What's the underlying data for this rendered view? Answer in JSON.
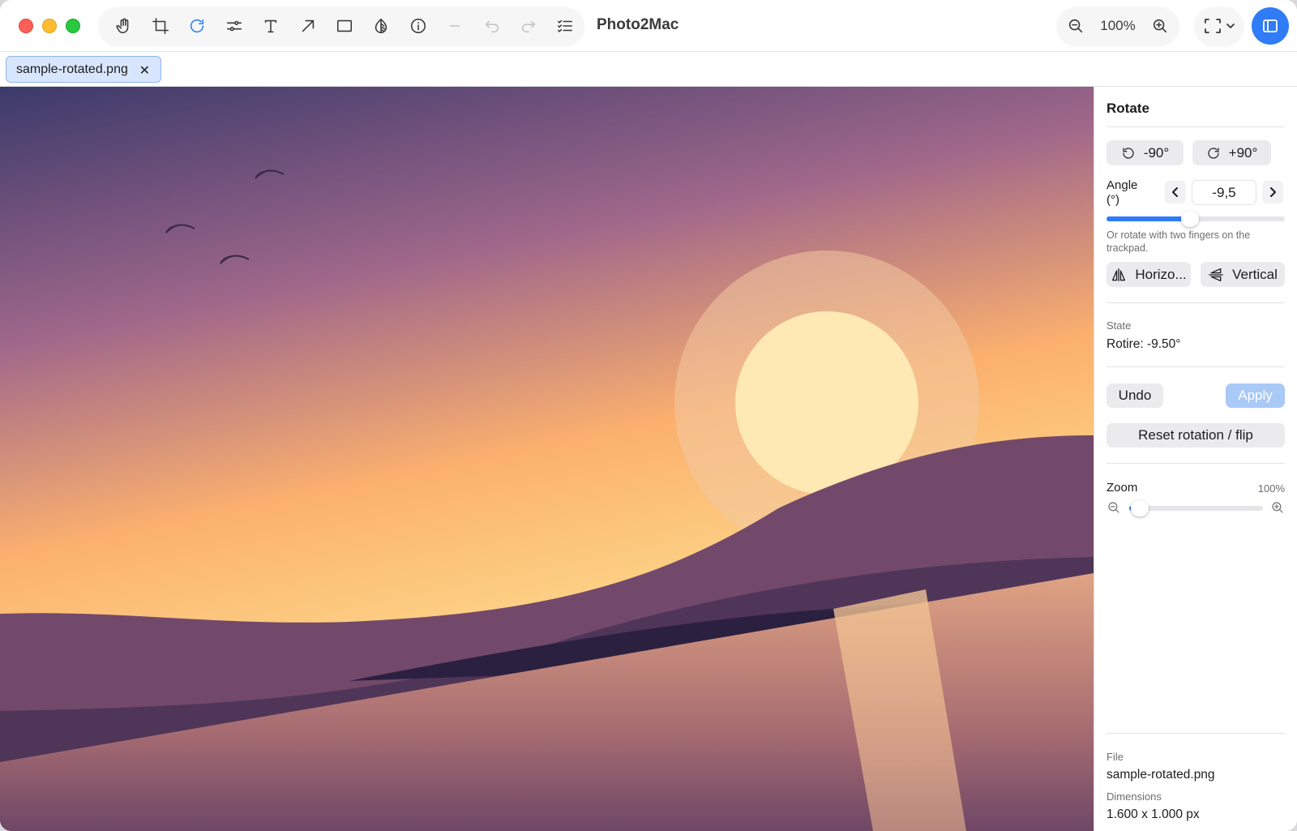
{
  "app": {
    "title": "Photo2Mac"
  },
  "toolbar": {
    "tools": [
      {
        "name": "hand-icon"
      },
      {
        "name": "crop-icon"
      },
      {
        "name": "rotate-icon",
        "active": true
      },
      {
        "name": "adjust-sliders-icon"
      },
      {
        "name": "text-icon"
      },
      {
        "name": "arrow-icon"
      },
      {
        "name": "rectangle-icon"
      },
      {
        "name": "mask-icon"
      },
      {
        "name": "info-icon"
      },
      {
        "name": "line-icon",
        "disabled": true
      },
      {
        "name": "undo-icon",
        "disabled": true
      },
      {
        "name": "redo-icon",
        "disabled": true
      },
      {
        "name": "checklist-icon"
      }
    ],
    "zoom_percent": "100%"
  },
  "tabs": [
    {
      "label": "sample-rotated.png",
      "close": "✕"
    }
  ],
  "sidebar": {
    "title": "Rotate",
    "rotate_left_label": "-90°",
    "rotate_right_label": "+90°",
    "angle_label": "Angle (°)",
    "angle_value": "-9,5",
    "angle_slider_fraction": 0.47,
    "hint": "Or rotate with two fingers on the trackpad.",
    "flip_horizontal_label": "Horizo...",
    "flip_vertical_label": "Vertical",
    "state_label": "State",
    "state_value": "Rotire: -9.50°",
    "undo_label": "Undo",
    "apply_label": "Apply",
    "reset_label": "Reset rotation / flip",
    "zoom_label": "Zoom",
    "zoom_value": "100%",
    "zoom_slider_fraction": 0.08,
    "file_label": "File",
    "file_value": "sample-rotated.png",
    "dimensions_label": "Dimensions",
    "dimensions_value": "1.600 x 1.000 px"
  },
  "colors": {
    "accent": "#2f7cf6",
    "sky_top": "#3b3a6b",
    "sky_mid": "#a0678a",
    "sky_low": "#fbb06e",
    "sun": "#fee8b3",
    "hill_light": "#73496b",
    "hill_dark": "#4f3558"
  }
}
